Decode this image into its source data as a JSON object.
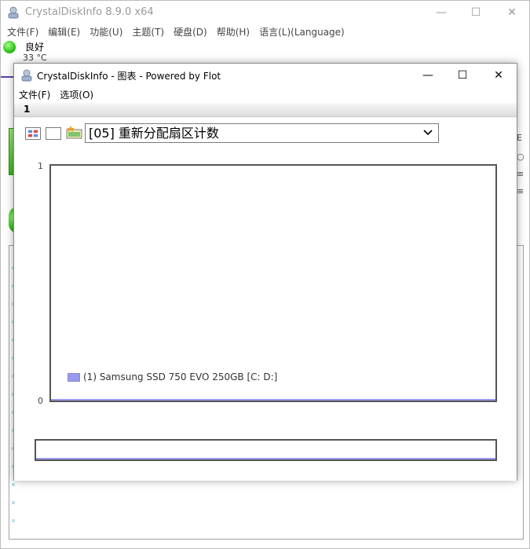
{
  "main_window": {
    "title": "CrystalDiskInfo 8.9.0 x64",
    "menu": [
      "文件(F)",
      "编辑(E)",
      "功能(U)",
      "主题(T)",
      "硬盘(D)",
      "帮助(H)",
      "语言(L)(Language)"
    ],
    "health": "良好",
    "temperature": "33 °C"
  },
  "graph_window": {
    "title": "CrystalDiskInfo - 图表 - Powered by Flot",
    "menu": [
      "文件(F)",
      "选项(O)"
    ],
    "status": "1",
    "attribute_select": "[05] 重新分配扇区计数",
    "legend_label": "(1) Samsung SSD 750 EVO 250GB [C: D:]"
  },
  "chart_data": {
    "type": "line",
    "series": [
      {
        "name": "(1) Samsung SSD 750 EVO 250GB [C: D:]",
        "values": [
          0
        ]
      }
    ],
    "y_ticks": [
      "1",
      "0"
    ],
    "ylim": [
      0,
      1
    ],
    "series_color": "#9999ee",
    "legend_position": "bottom-left"
  },
  "colors": {
    "health_good": "#2fc21a",
    "series": "#9999ee",
    "accent_line": "#5a3fb0"
  }
}
